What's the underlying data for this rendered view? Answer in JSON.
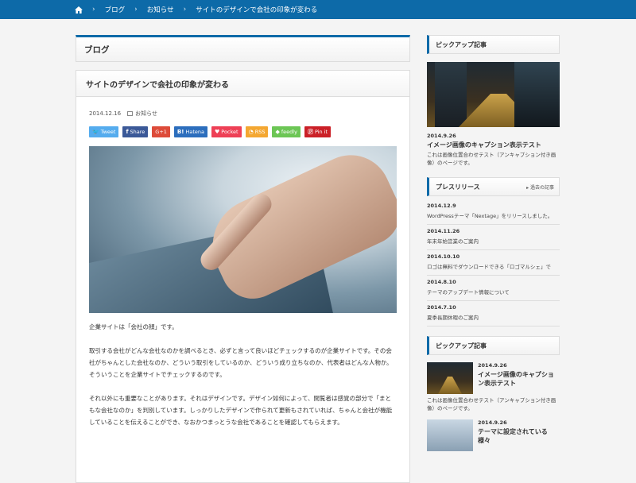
{
  "breadcrumb": {
    "items": [
      "ブログ",
      "お知らせ",
      "サイトのデザインで会社の印象が変わる"
    ]
  },
  "main": {
    "page_title": "ブログ",
    "article": {
      "title": "サイトのデザインで会社の印象が変わる",
      "date": "2014.12.16",
      "category": "お知らせ",
      "share_buttons": [
        {
          "icon": "twitter-icon",
          "label": "Tweet",
          "color": "#55acee"
        },
        {
          "icon": "facebook-icon",
          "label": "Share",
          "color": "#3b5998"
        },
        {
          "icon": "googleplus-icon",
          "label": "G+1",
          "color": "#dd4b39"
        },
        {
          "icon": "hatena-icon",
          "label": "Hatena",
          "color": "#2c6ebd"
        },
        {
          "icon": "pocket-icon",
          "label": "Pocket",
          "color": "#ee4056"
        },
        {
          "icon": "rss-icon",
          "label": "RSS",
          "color": "#f4a731"
        },
        {
          "icon": "feedly-icon",
          "label": "feedly",
          "color": "#6cc655"
        },
        {
          "icon": "pinterest-icon",
          "label": "Pin it",
          "color": "#cb2027"
        }
      ],
      "paragraphs": [
        "企業サイトは「会社の顔」です。",
        "取引する会社がどんな会社なのかを調べるとき、必ずと言って良いほどチェックするのが企業サイトです。その会社がちゃんとした会社なのか、どういう取引をしているのか、どういう成り立ちなのか、代表者はどんな人物か。そういうことを企業サイトでチェックするのです。",
        "それ以外にも重要なことがあります。それはデザインです。デザイン如何によって、閲覧者は感覚の部分で「まともな会社なのか」を判別しています。しっかりしたデザインで作られて更新もされていれば、ちゃんと会社が機能していることを伝えることができ、なおかつまっとうな会社であることを確認してもらえます。"
      ]
    }
  },
  "sidebar": {
    "pickup": {
      "heading": "ピックアップ記事",
      "date": "2014.9.26",
      "title": "イメージ画像のキャプション表示テスト",
      "desc": "これは画像位置合わせテスト（アンキャプション付き画像）のページです。"
    },
    "press": {
      "heading": "プレスリリース",
      "more_label": "過去の記事",
      "items": [
        {
          "date": "2014.12.9",
          "title": "WordPressテーマ「Nextage」をリリースしました。"
        },
        {
          "date": "2014.11.26",
          "title": "年末年始営業のご案内"
        },
        {
          "date": "2014.10.10",
          "title": "ロゴは無料でダウンロードできる「ロゴマルシェ」で"
        },
        {
          "date": "2014.8.10",
          "title": "テーマのアップデート情報について"
        },
        {
          "date": "2014.7.10",
          "title": "夏季長期休暇のご案内"
        }
      ]
    },
    "pickup2": {
      "heading": "ピックアップ記事",
      "items": [
        {
          "date": "2014.9.26",
          "title": "イメージ画像のキャプション表示テスト",
          "desc": "これは画像位置合わせテスト（アンキャプション付き画像）のページです。"
        },
        {
          "date": "2014.9.26",
          "title": "テーマに設定されている様々"
        }
      ]
    }
  }
}
